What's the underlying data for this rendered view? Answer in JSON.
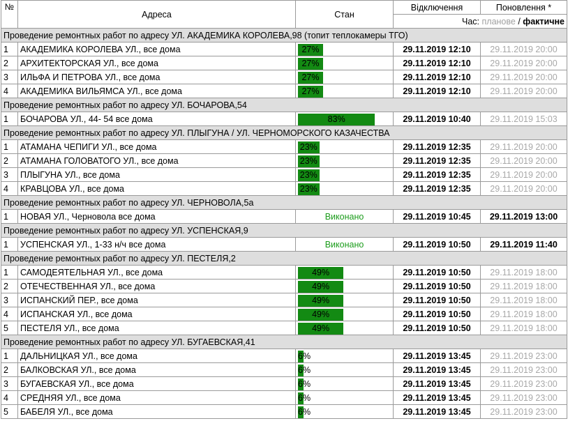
{
  "header": {
    "num": "№",
    "address": "Адреса",
    "state": "Стан",
    "disconnect": "Відключення",
    "update": "Поновлення *",
    "time_label": "Час:",
    "planned": "планове",
    "separator": "/",
    "actual": "фактичне"
  },
  "colors": {
    "bar": "#138a13",
    "done": "#1b9c1b",
    "group_bg": "#dedede",
    "planned_gray": "#a8a8a8"
  },
  "groups": [
    {
      "title": "Проведение ремонтных работ по адресу УЛ. АКАДЕМИКА КОРОЛЕВА,98 (топит теплокамеры ТГО)",
      "rows": [
        {
          "n": "1",
          "addr": "АКАДЕМИКА КОРОЛЕВА УЛ., все дома",
          "pct": 27,
          "pct_label": "27%",
          "done": "",
          "disc": "29.11.2019 12:10",
          "upd": "29.11.2019 20:00",
          "upd_actual": false
        },
        {
          "n": "2",
          "addr": "АРХИТЕКТОРСКАЯ УЛ., все дома",
          "pct": 27,
          "pct_label": "27%",
          "done": "",
          "disc": "29.11.2019 12:10",
          "upd": "29.11.2019 20:00",
          "upd_actual": false
        },
        {
          "n": "3",
          "addr": "ИЛЬФА И ПЕТРОВА УЛ., все дома",
          "pct": 27,
          "pct_label": "27%",
          "done": "",
          "disc": "29.11.2019 12:10",
          "upd": "29.11.2019 20:00",
          "upd_actual": false
        },
        {
          "n": "4",
          "addr": "АКАДЕМИКА ВИЛЬЯМСА УЛ., все дома",
          "pct": 27,
          "pct_label": "27%",
          "done": "",
          "disc": "29.11.2019 12:10",
          "upd": "29.11.2019 20:00",
          "upd_actual": false
        }
      ]
    },
    {
      "title": "Проведение ремонтных работ по адресу УЛ. БОЧАРОВА,54",
      "rows": [
        {
          "n": "1",
          "addr": "БОЧАРОВА УЛ., 44- 54 все дома",
          "pct": 83,
          "pct_label": "83%",
          "done": "",
          "disc": "29.11.2019 10:40",
          "upd": "29.11.2019 15:03",
          "upd_actual": false
        }
      ]
    },
    {
      "title": "Проведение ремонтных работ по адресу УЛ. ПЛЫГУНА / УЛ. ЧЕРНОМОРСКОГО КАЗАЧЕСТВА",
      "rows": [
        {
          "n": "1",
          "addr": "АТАМАНА ЧЕПИГИ УЛ., все дома",
          "pct": 23,
          "pct_label": "23%",
          "done": "",
          "disc": "29.11.2019 12:35",
          "upd": "29.11.2019 20:00",
          "upd_actual": false
        },
        {
          "n": "2",
          "addr": "АТАМАНА ГОЛОВАТОГО УЛ., все дома",
          "pct": 23,
          "pct_label": "23%",
          "done": "",
          "disc": "29.11.2019 12:35",
          "upd": "29.11.2019 20:00",
          "upd_actual": false
        },
        {
          "n": "3",
          "addr": "ПЛЫГУНА УЛ., все дома",
          "pct": 23,
          "pct_label": "23%",
          "done": "",
          "disc": "29.11.2019 12:35",
          "upd": "29.11.2019 20:00",
          "upd_actual": false
        },
        {
          "n": "4",
          "addr": "КРАВЦОВА УЛ., все дома",
          "pct": 23,
          "pct_label": "23%",
          "done": "",
          "disc": "29.11.2019 12:35",
          "upd": "29.11.2019 20:00",
          "upd_actual": false
        }
      ]
    },
    {
      "title": "Проведение ремонтных работ по адресу УЛ. ЧЕРНОВОЛА,5а",
      "rows": [
        {
          "n": "1",
          "addr": "НОВАЯ УЛ., Черновола все дома",
          "pct": null,
          "pct_label": "",
          "done": "Виконано",
          "disc": "29.11.2019 10:45",
          "upd": "29.11.2019 13:00",
          "upd_actual": true
        }
      ]
    },
    {
      "title": "Проведение ремонтных работ по адресу УЛ. УСПЕНСКАЯ,9",
      "rows": [
        {
          "n": "1",
          "addr": "УСПЕНСКАЯ УЛ., 1-33 н/ч все дома",
          "pct": null,
          "pct_label": "",
          "done": "Виконано",
          "disc": "29.11.2019 10:50",
          "upd": "29.11.2019 11:40",
          "upd_actual": true
        }
      ]
    },
    {
      "title": "Проведение ремонтных работ по адресу УЛ. ПЕСТЕЛЯ,2",
      "rows": [
        {
          "n": "1",
          "addr": "САМОДЕЯТЕЛЬНАЯ УЛ., все дома",
          "pct": 49,
          "pct_label": "49%",
          "done": "",
          "disc": "29.11.2019 10:50",
          "upd": "29.11.2019 18:00",
          "upd_actual": false
        },
        {
          "n": "2",
          "addr": "ОТЕЧЕСТВЕННАЯ УЛ., все дома",
          "pct": 49,
          "pct_label": "49%",
          "done": "",
          "disc": "29.11.2019 10:50",
          "upd": "29.11.2019 18:00",
          "upd_actual": false
        },
        {
          "n": "3",
          "addr": "ИСПАНСКИЙ ПЕР., все дома",
          "pct": 49,
          "pct_label": "49%",
          "done": "",
          "disc": "29.11.2019 10:50",
          "upd": "29.11.2019 18:00",
          "upd_actual": false
        },
        {
          "n": "4",
          "addr": "ИСПАНСКАЯ УЛ., все дома",
          "pct": 49,
          "pct_label": "49%",
          "done": "",
          "disc": "29.11.2019 10:50",
          "upd": "29.11.2019 18:00",
          "upd_actual": false
        },
        {
          "n": "5",
          "addr": "ПЕСТЕЛЯ УЛ., все дома",
          "pct": 49,
          "pct_label": "49%",
          "done": "",
          "disc": "29.11.2019 10:50",
          "upd": "29.11.2019 18:00",
          "upd_actual": false
        }
      ]
    },
    {
      "title": "Проведение ремонтных работ по адресу УЛ. БУГАЕВСКАЯ,41",
      "rows": [
        {
          "n": "1",
          "addr": "ДАЛЬНИЦКАЯ УЛ., все дома",
          "pct": 6,
          "pct_label": "6%",
          "done": "",
          "disc": "29.11.2019 13:45",
          "upd": "29.11.2019 23:00",
          "upd_actual": false
        },
        {
          "n": "2",
          "addr": "БАЛКОВСКАЯ УЛ., все дома",
          "pct": 6,
          "pct_label": "6%",
          "done": "",
          "disc": "29.11.2019 13:45",
          "upd": "29.11.2019 23:00",
          "upd_actual": false
        },
        {
          "n": "3",
          "addr": "БУГАЕВСКАЯ УЛ., все дома",
          "pct": 6,
          "pct_label": "6%",
          "done": "",
          "disc": "29.11.2019 13:45",
          "upd": "29.11.2019 23:00",
          "upd_actual": false
        },
        {
          "n": "4",
          "addr": "СРЕДНЯЯ УЛ., все дома",
          "pct": 6,
          "pct_label": "6%",
          "done": "",
          "disc": "29.11.2019 13:45",
          "upd": "29.11.2019 23:00",
          "upd_actual": false
        },
        {
          "n": "5",
          "addr": "БАБЕЛЯ УЛ., все дома",
          "pct": 6,
          "pct_label": "6%",
          "done": "",
          "disc": "29.11.2019 13:45",
          "upd": "29.11.2019 23:00",
          "upd_actual": false
        }
      ]
    }
  ]
}
